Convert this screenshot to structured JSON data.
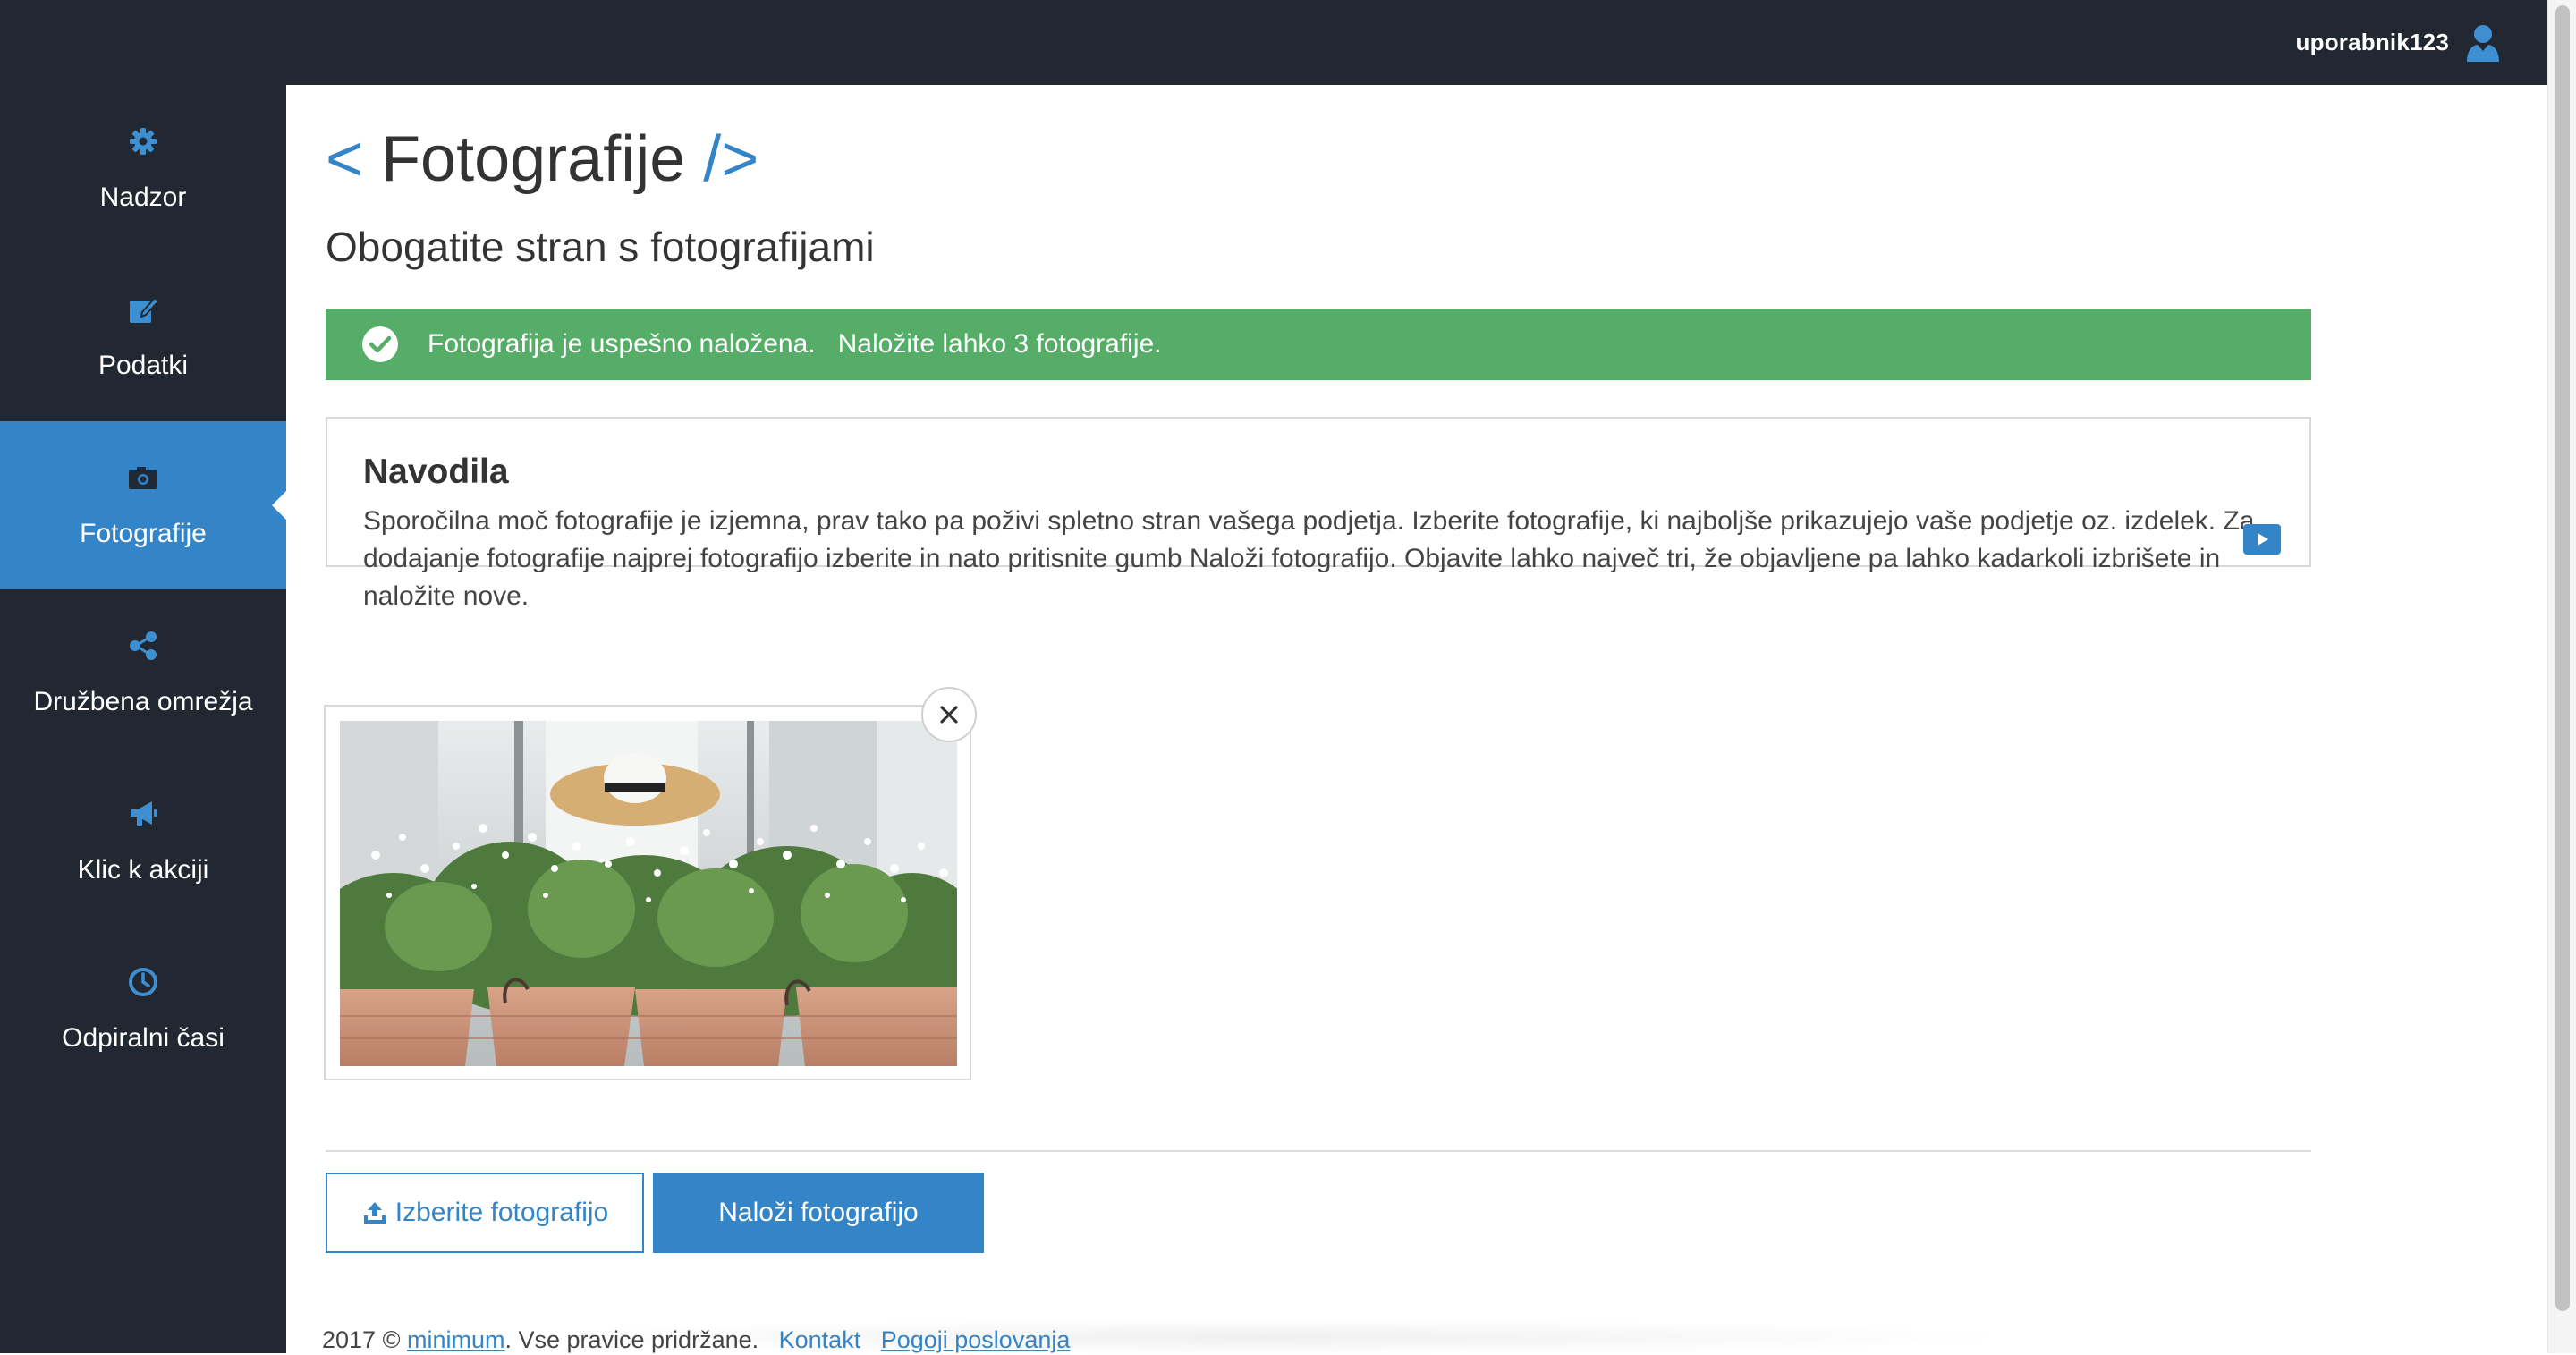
{
  "header": {
    "username": "uporabnik123",
    "user_icon": "user-icon"
  },
  "sidebar": {
    "items": [
      {
        "label": "Nadzor",
        "icon": "gear-icon",
        "active": false
      },
      {
        "label": "Podatki",
        "icon": "edit-icon",
        "active": false
      },
      {
        "label": "Fotografije",
        "icon": "camera-icon",
        "active": true
      },
      {
        "label": "Družbena omrežja",
        "icon": "share-icon",
        "active": false
      },
      {
        "label": "Klic k akciji",
        "icon": "megaphone-icon",
        "active": false
      },
      {
        "label": "Odpiralni časi",
        "icon": "clock-icon",
        "active": false
      }
    ]
  },
  "page": {
    "title_open": "<",
    "title": "Fotografije",
    "title_close": "/>",
    "subtitle": "Obogatite stran s fotografijami"
  },
  "alert": {
    "type": "success",
    "text": "Fotografija je uspešno naložena.   Naložite lahko 3 fotografije.",
    "icon": "check-circle-icon"
  },
  "instructions": {
    "title": "Navodila",
    "body": "Sporočilna moč fotografije je izjemna, prav tako pa poživi spletno stran vašega podjetja. Izberite fotografije, ki najboljše prikazujejo vaše podjetje oz. izdelek. Za dodajanje fotografije najprej fotografijo izberite in nato pritisnite gumb Naloži fotografijo. Objavite lahko največ tri, že objavljene pa lahko kadarkoli izbrišete in naložite nove.",
    "video_icon": "play-icon"
  },
  "photos": [
    {
      "description": "photo-thumbnail",
      "remove_icon": "close-icon"
    }
  ],
  "buttons": {
    "choose_label": "Izberite fotografijo",
    "choose_icon": "upload-icon",
    "upload_label": "Naloži fotografijo"
  },
  "footer": {
    "copyright": "2017 © ",
    "brand": "minimum",
    "rights": ". Vse pravice pridržane.",
    "link_contact": "Kontakt",
    "link_terms": "Pogoji poslovanja"
  },
  "colors": {
    "dark": "#222831",
    "accent": "#3385c8",
    "success": "#56ad67"
  }
}
